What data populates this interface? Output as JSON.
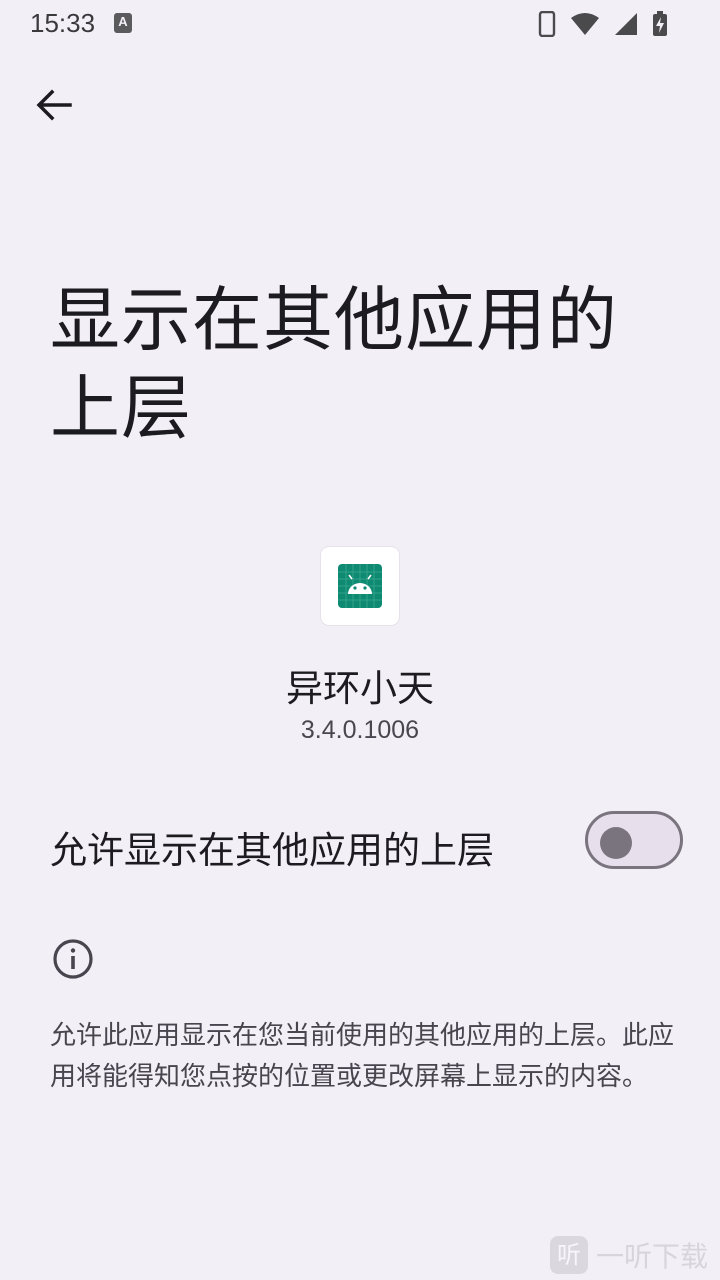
{
  "status_bar": {
    "time": "15:33",
    "notification_badge": "A",
    "icons": [
      "phone-icon",
      "wifi-icon",
      "signal-icon",
      "battery-charging-icon"
    ]
  },
  "header": {
    "back_icon": "arrow-back-icon"
  },
  "page": {
    "title": "显示在其他应用的上层"
  },
  "app": {
    "icon": "android-icon",
    "icon_color": "#0f8a72",
    "name": "异环小天",
    "version": "3.4.0.1006"
  },
  "permission": {
    "toggle_label": "允许显示在其他应用的上层",
    "enabled": false
  },
  "info": {
    "icon": "info-icon",
    "description": "允许此应用显示在您当前使用的其他应用的上层。此应用将能得知您点按的位置或更改屏幕上显示的内容。"
  },
  "watermark": {
    "logo_char": "听",
    "text": "一听下载"
  },
  "colors": {
    "background": "#f3eff6",
    "switch_outline": "#79747e",
    "switch_track": "#e7e0ec"
  }
}
